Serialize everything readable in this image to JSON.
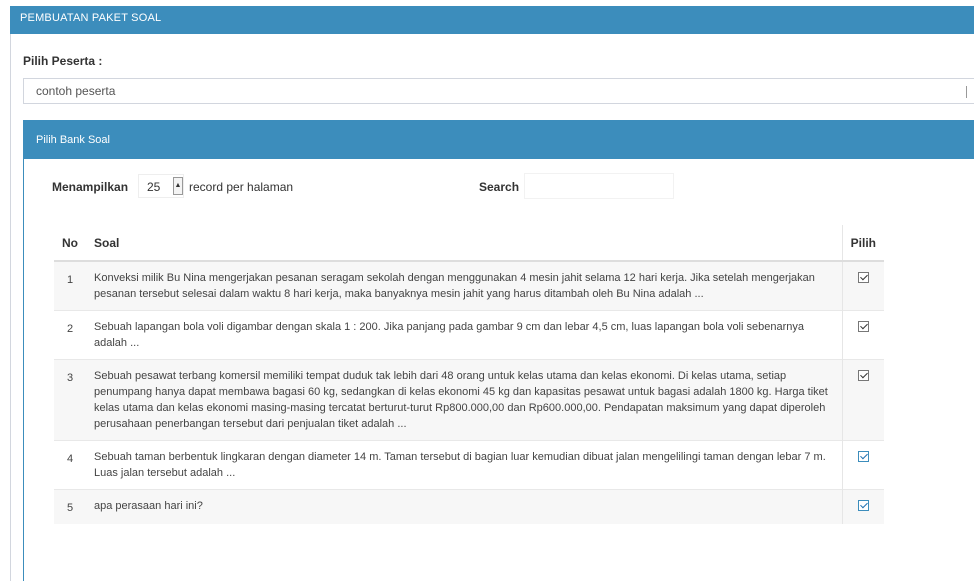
{
  "header": {
    "title": "PEMBUATAN PAKET SOAL"
  },
  "peserta": {
    "label": "Pilih Peserta :",
    "selected": "contoh peserta"
  },
  "bank_soal": {
    "title": "Pilih Bank Soal",
    "show_label": "Menampilkan",
    "length_value": "25",
    "per_page_label": "record per halaman",
    "search_label": "Search"
  },
  "table": {
    "headers": {
      "no": "No",
      "soal": "Soal",
      "pilih": "Pilih"
    },
    "rows": [
      {
        "no": "1",
        "soal": "Konveksi milik Bu Nina mengerjakan pesanan seragam sekolah dengan menggunakan 4 mesin jahit selama 12 hari kerja. Jika setelah mengerjakan pesanan tersebut selesai dalam waktu 8 hari kerja, maka banyaknya mesin jahit yang harus ditambah oleh Bu Nina adalah ...",
        "checked": true
      },
      {
        "no": "2",
        "soal": "Sebuah lapangan bola voli digambar dengan skala 1 : 200. Jika panjang pada gambar 9 cm dan lebar 4,5 cm, luas lapangan bola voli sebenarnya adalah ...",
        "checked": true
      },
      {
        "no": "3",
        "soal": "Sebuah pesawat terbang komersil memiliki tempat duduk tak lebih dari 48 orang untuk kelas utama dan kelas ekonomi. Di kelas utama, setiap penumpang hanya dapat membawa bagasi 60 kg, sedangkan di kelas ekonomi 45 kg dan kapasitas pesawat untuk bagasi adalah 1800 kg. Harga tiket kelas utama dan kelas ekonomi masing-masing tercatat berturut-turut Rp800.000,00 dan Rp600.000,00. Pendapatan maksimum yang dapat diperoleh perusahaan penerbangan tersebut dari penjualan tiket adalah ...",
        "checked": true
      },
      {
        "no": "4",
        "soal": "Sebuah taman berbentuk lingkaran dengan diameter 14 m. Taman tersebut di bagian luar kemudian dibuat jalan mengelilingi taman dengan lebar 7 m. Luas jalan tersebut adalah ...",
        "checked": true
      },
      {
        "no": "5",
        "soal": "apa perasaan hari ini?",
        "checked": true
      }
    ]
  },
  "colors": {
    "primary": "#3c8dbc",
    "border": "#d2d6de"
  }
}
